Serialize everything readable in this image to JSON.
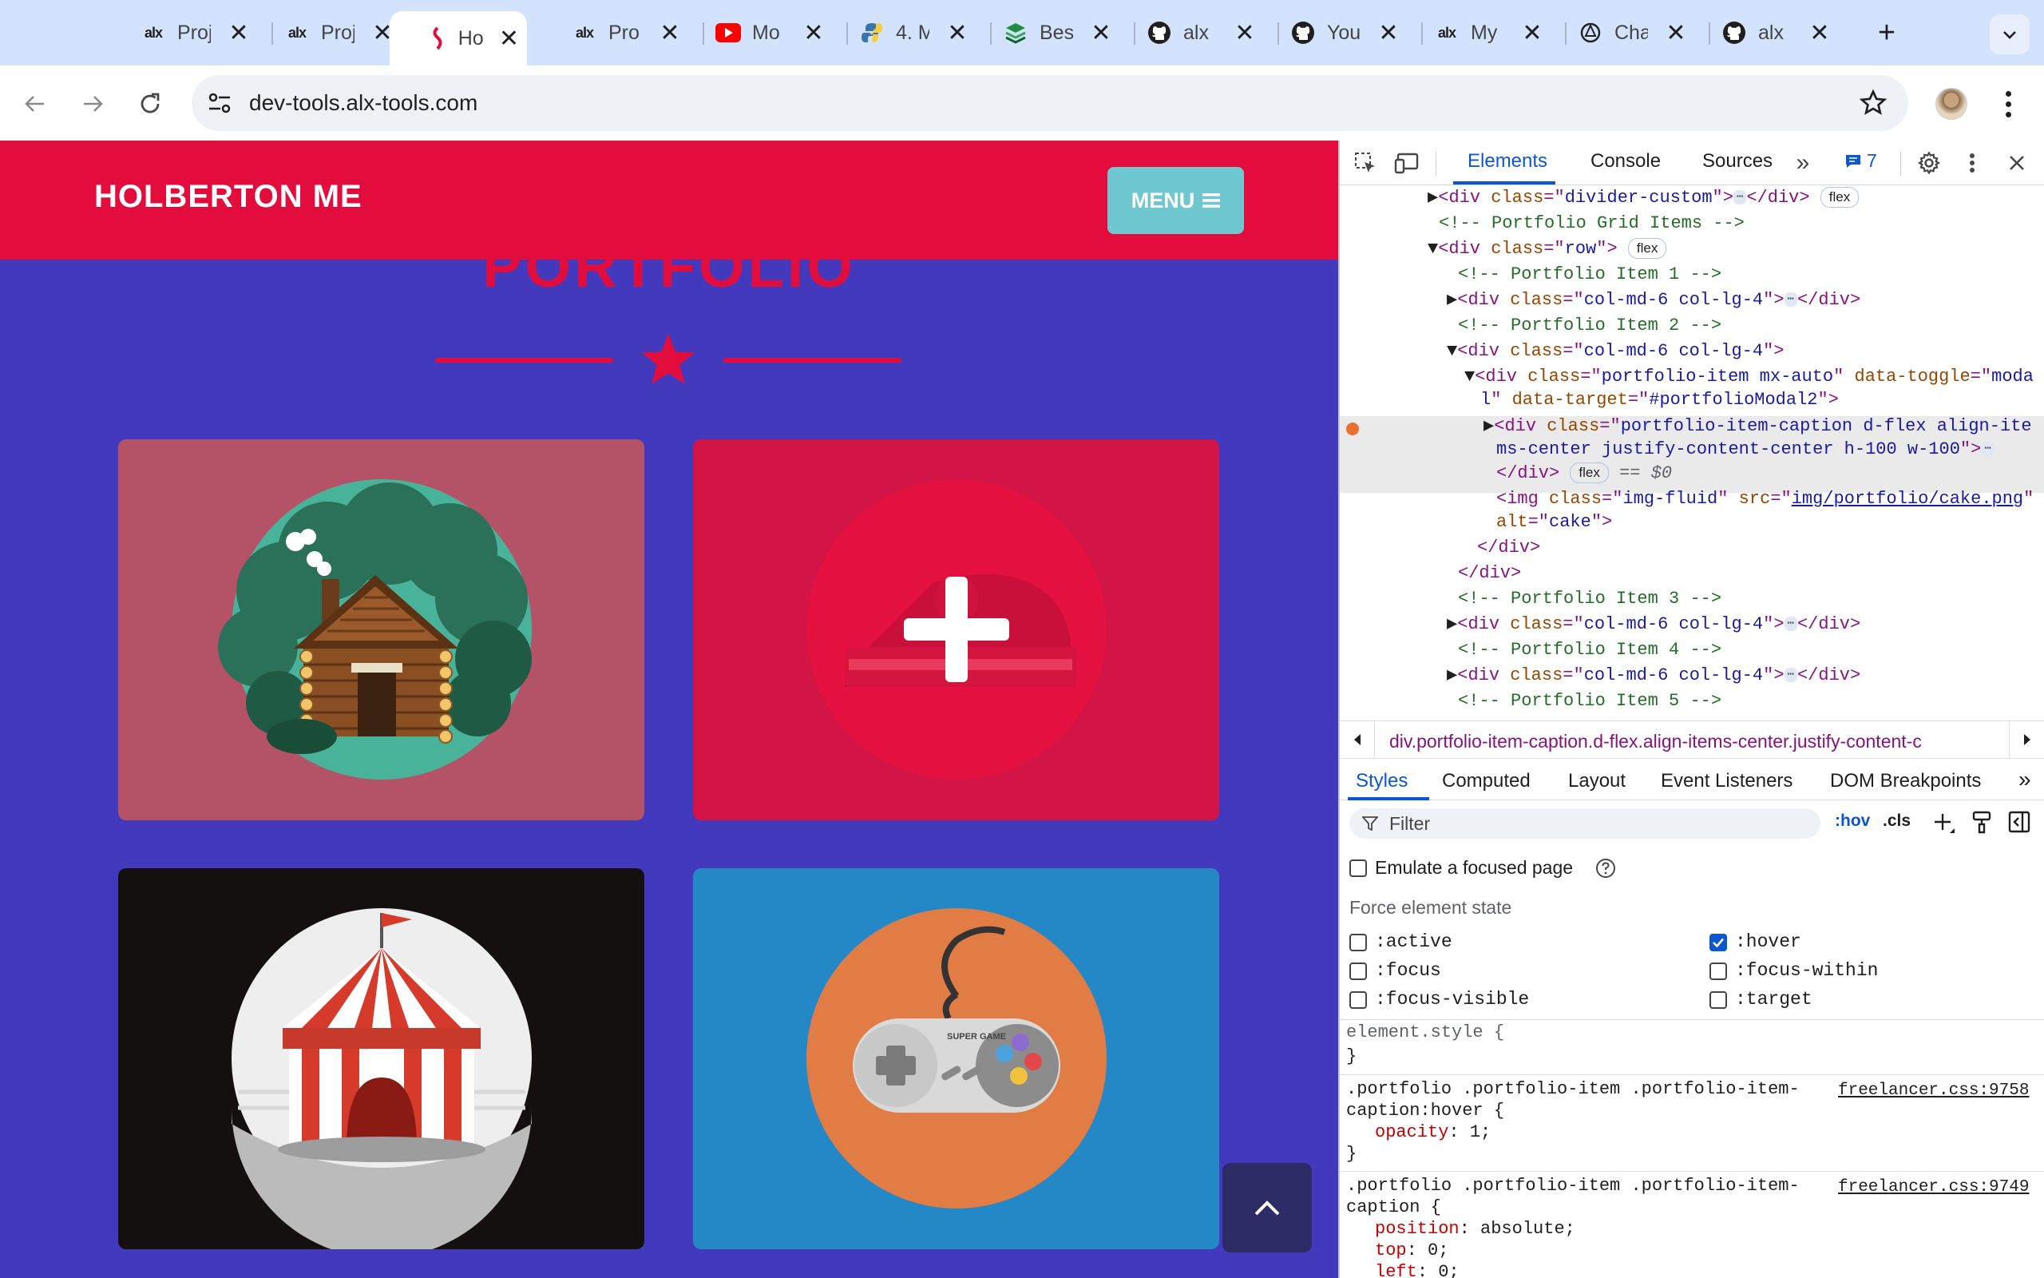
{
  "browser": {
    "tabs": [
      {
        "favicon": "alx-icon",
        "title": "Proj"
      },
      {
        "favicon": "alx-icon",
        "title": "Proj"
      },
      {
        "favicon": "holberton-icon",
        "title": "Hol",
        "active": true
      },
      {
        "favicon": "alx-icon",
        "title": "Pro"
      },
      {
        "favicon": "youtube-icon",
        "title": "Mo"
      },
      {
        "favicon": "python-icon",
        "title": "4. M"
      },
      {
        "favicon": "stack-icon",
        "title": "Bes"
      },
      {
        "favicon": "github-icon",
        "title": "alx"
      },
      {
        "favicon": "github-icon",
        "title": "You"
      },
      {
        "favicon": "alx-icon",
        "title": "My"
      },
      {
        "favicon": "openai-icon",
        "title": "Cha"
      },
      {
        "favicon": "github-icon",
        "title": "alx"
      }
    ],
    "url": "dev-tools.alx-tools.com",
    "new_tab": "+",
    "tab_close": "✕"
  },
  "page": {
    "brand": "HOLBERTON ME",
    "menu_label": "MENU",
    "section_title": "PORTFOLIO",
    "items": [
      {
        "name": "cabin",
        "bg": "#b45267"
      },
      {
        "name": "cake",
        "bg": "#d31447"
      },
      {
        "name": "circus",
        "bg": "#141010"
      },
      {
        "name": "game",
        "bg": "#2488c7"
      }
    ],
    "controller_text": "SUPER GAME"
  },
  "devtools": {
    "tabs": [
      "Elements",
      "Console",
      "Sources"
    ],
    "issues_count": "7",
    "tree": {
      "l1_class": "divider-custom",
      "l2_comment": "<!-- Portfolio Grid Items -->",
      "l3_class": "row",
      "c1": "<!-- Portfolio Item 1 -->",
      "col_class": "col-md-6 col-lg-4",
      "c2": "<!-- Portfolio Item 2 -->",
      "pi_class": "portfolio-item mx-auto",
      "pi_toggle_a": "moda",
      "pi_toggle_b": "l",
      "pi_target": "#portfolioModal2",
      "cap_class_a": "portfolio-item-caption d-flex align-ite",
      "cap_class_b": "ms-center justify-content-center h-100 w-100",
      "eq": "== $0",
      "img_class": "img-fluid",
      "img_src": "img/portfolio/cake.png",
      "img_alt": "cake",
      "c3": "<!-- Portfolio Item 3 -->",
      "c4": "<!-- Portfolio Item 4 -->",
      "c5": "<!-- Portfolio Item 5 -->",
      "flex": "flex"
    },
    "breadcrumb": "div.portfolio-item-caption.d-flex.align-items-center.justify-content-c",
    "styles_tabs": [
      "Styles",
      "Computed",
      "Layout",
      "Event Listeners",
      "DOM Breakpoints"
    ],
    "filter_placeholder": "Filter",
    "hov": ":hov",
    "cls": ".cls",
    "emulate_focus": "Emulate a focused page",
    "force_state": "Force element state",
    "states": {
      "active": ":active",
      "hover": ":hover",
      "focus": ":focus",
      "focus_within": ":focus-within",
      "focus_visible": ":focus-visible",
      "target": ":target"
    },
    "rules": {
      "element_style": "element.style {",
      "close": "}",
      "r1_sel_a": ".portfolio .portfolio-item .portfolio-item-",
      "r1_sel_b": "caption:hover {",
      "r1_src": "freelancer.css:9758",
      "r1_prop": "opacity",
      "r1_val": "1;",
      "r2_sel_a": ".portfolio .portfolio-item .portfolio-item-",
      "r2_sel_b": "caption {",
      "r2_src": "freelancer.css:9749",
      "r2_p1": "position",
      "r2_v1": "absolute;",
      "r2_p2": "top",
      "r2_v2": "0;",
      "r2_p3": "left",
      "r2_v3": "0;"
    }
  }
}
